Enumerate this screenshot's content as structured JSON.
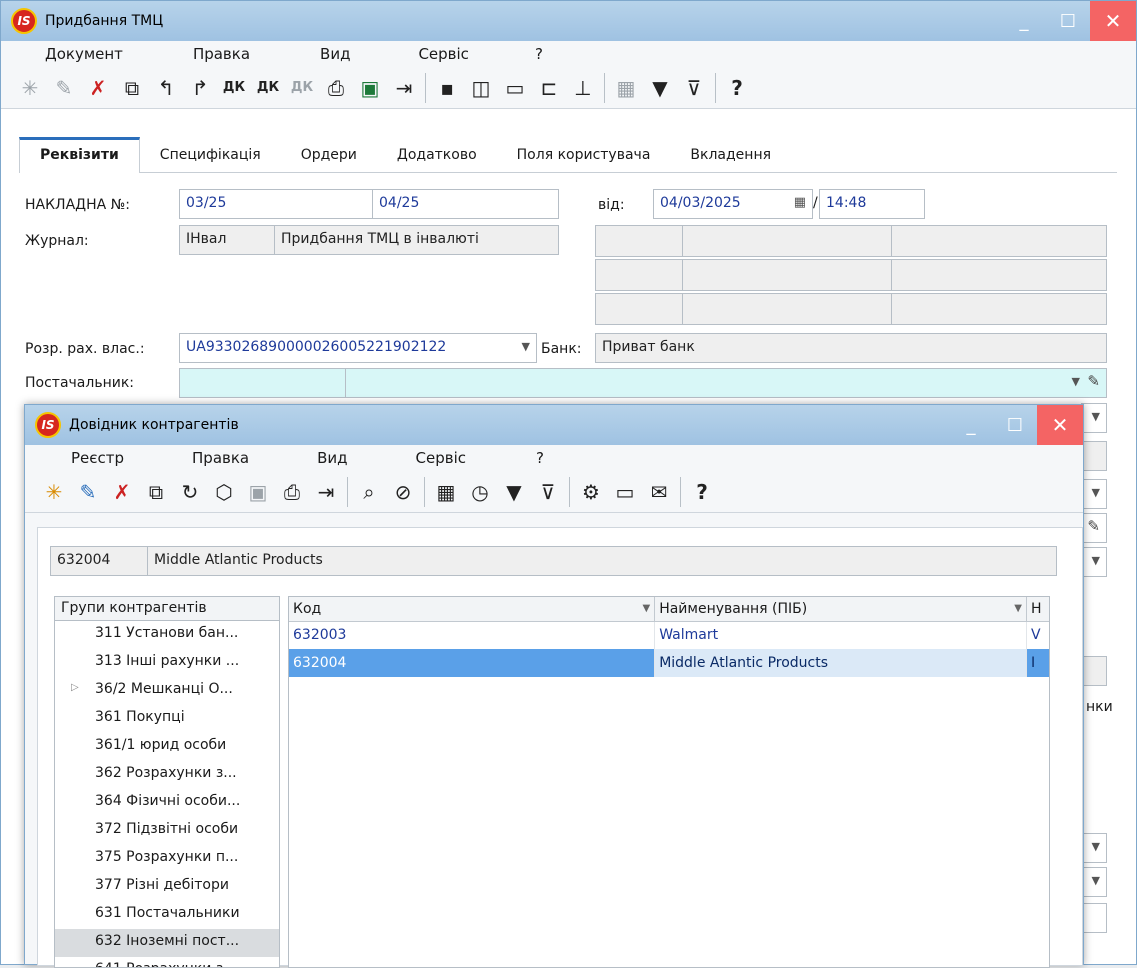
{
  "main_window": {
    "title": "Придбання ТМЦ",
    "menu": [
      "Документ",
      "Правка",
      "Вид",
      "Сервіс",
      "?"
    ],
    "tabs": [
      "Реквізити",
      "Специфікація",
      "Ордери",
      "Додатково",
      "Поля користувача",
      "Вкладення"
    ],
    "active_tab": "Реквізити",
    "invoice_label": "НАКЛАДНА №:",
    "invoice_no_1": "03/25",
    "invoice_no_2": "04/25",
    "date_label": "від:",
    "date": "04/03/2025",
    "date_sep": "/",
    "time": "14:48",
    "journal_label": "Журнал:",
    "journal_code": "ІНвал",
    "journal_name": "Придбання ТМЦ в інвалюті",
    "account_label": "Розр. рах. влас.:",
    "account": "UA933026890000026005221902122",
    "bank_label": "Банк:",
    "bank": "Приват банк",
    "supplier_label": "Постачальник:",
    "right_partial_text": "нки"
  },
  "dialog": {
    "title": "Довідник контрагентів",
    "menu": [
      "Реєстр",
      "Правка",
      "Вид",
      "Сервіс",
      "?"
    ],
    "selected_code": "632004",
    "selected_name": "Middle Atlantic Products",
    "groups_header": "Групи контрагентів",
    "groups": [
      "311 Установи бан...",
      "313 Інші рахунки ...",
      "36/2 Мешканці О...",
      "361 Покупці",
      "361/1 юрид особи",
      "362 Розрахунки з...",
      "364 Фізичні особи...",
      "372 Підзвітні особи",
      "375 Розрахунки п...",
      "377 Різні дебітори",
      "631 Постачальники",
      "632 Іноземні пост...",
      "641 Розрахунки з..."
    ],
    "columns": [
      "Код",
      "Найменування (ПІБ)",
      "Н"
    ],
    "rows": [
      {
        "code": "632003",
        "name": "Walmart",
        "extra": "V"
      },
      {
        "code": "632004",
        "name": "Middle Atlantic Products",
        "extra": "I"
      }
    ]
  }
}
